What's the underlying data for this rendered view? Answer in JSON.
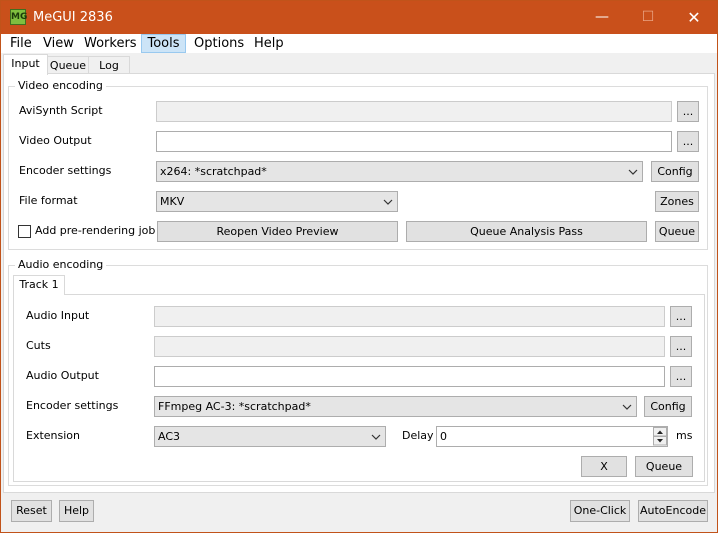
{
  "window": {
    "title": "MeGUI 2836",
    "icon": "megui-app-icon",
    "icon_glyph": "MG",
    "min_glyph": "—",
    "max_glyph": "☐",
    "close_glyph": "✕",
    "titlebar_color": "#c9501b"
  },
  "menu": [
    "File",
    "View",
    "Workers",
    "Tools",
    "Options",
    "Help"
  ],
  "tabs": [
    "Input",
    "Queue",
    "Log"
  ],
  "video": {
    "group_title": "Video encoding",
    "avisynth_label": "AviSynth Script",
    "avisynth_value": "",
    "video_output_label": "Video Output",
    "video_output_value": "",
    "encoder_label": "Encoder settings",
    "encoder_value": "x264: *scratchpad*",
    "file_format_label": "File format",
    "file_format_value": "MKV",
    "prerender_label": "Add pre-rendering job",
    "prerender_checked": false,
    "browse_label": "...",
    "config_label": "Config",
    "zones_label": "Zones",
    "reopen_preview_label": "Reopen Video Preview",
    "queue_analysis_label": "Queue Analysis Pass",
    "queue_label": "Queue"
  },
  "audio": {
    "group_title": "Audio encoding",
    "track_tab": "Track 1",
    "audio_input_label": "Audio Input",
    "audio_input_value": "",
    "cuts_label": "Cuts",
    "cuts_value": "",
    "audio_output_label": "Audio Output",
    "audio_output_value": "",
    "encoder_label": "Encoder settings",
    "encoder_value": "FFmpeg AC-3: *scratchpad*",
    "extension_label": "Extension",
    "extension_value": "AC3",
    "delay_label": "Delay",
    "delay_value": "0",
    "delay_unit": "ms",
    "browse_label": "...",
    "config_label": "Config",
    "x_label": "X",
    "queue_label": "Queue"
  },
  "bottom": {
    "reset_label": "Reset",
    "help_label": "Help",
    "one_click_label": "One-Click",
    "autoencode_label": "AutoEncode"
  }
}
